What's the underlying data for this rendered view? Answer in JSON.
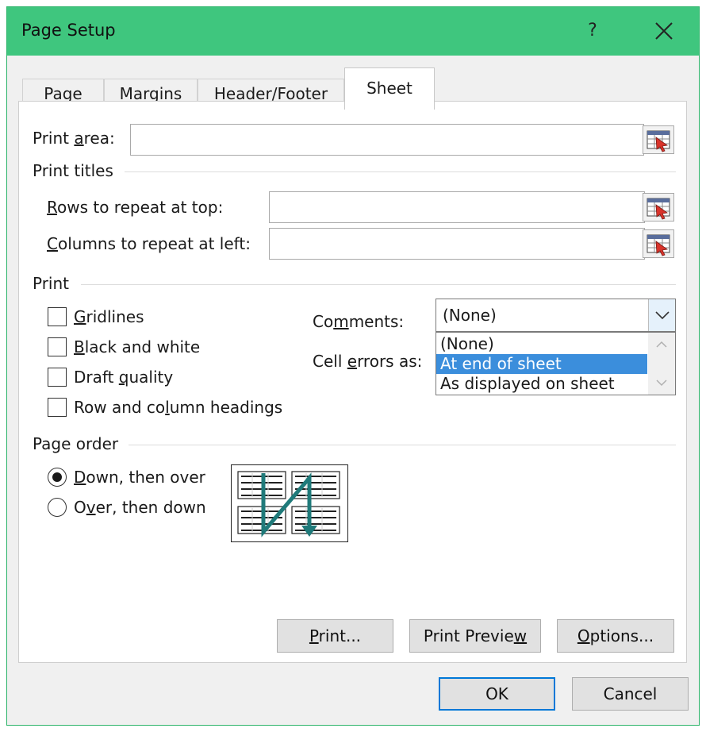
{
  "window": {
    "title": "Page Setup",
    "help_label": "?"
  },
  "tabs": [
    {
      "label": "Page",
      "active": false
    },
    {
      "label": "Margins",
      "active": false
    },
    {
      "label": "Header/Footer",
      "active": false
    },
    {
      "label": "Sheet",
      "active": true
    }
  ],
  "print_area": {
    "pre": "Print ",
    "accel": "a",
    "post": "rea:",
    "value": ""
  },
  "print_titles": {
    "heading": "Print titles",
    "rows": {
      "pre": "",
      "accel": "R",
      "post": "ows to repeat at top:",
      "value": ""
    },
    "columns": {
      "pre": "",
      "accel": "C",
      "post": "olumns to repeat at left:",
      "value": ""
    }
  },
  "print": {
    "heading": "Print",
    "gridlines": {
      "pre": "",
      "accel": "G",
      "post": "ridlines",
      "checked": false
    },
    "black_white": {
      "pre": "",
      "accel": "B",
      "post": "lack and white",
      "checked": false
    },
    "draft": {
      "pre": "Draft ",
      "accel": "q",
      "post": "uality",
      "checked": false
    },
    "headings": {
      "pre": "Row and co",
      "accel": "l",
      "post": "umn headings",
      "checked": false
    },
    "comments": {
      "pre": "Co",
      "accel": "m",
      "post": "ments:",
      "selected": "(None)"
    },
    "cell_errors": {
      "pre": "Cell ",
      "accel": "e",
      "post": "rrors as:"
    },
    "dropdown_options": [
      "(None)",
      "At end of sheet",
      "As displayed on sheet"
    ],
    "dropdown_highlighted": 1
  },
  "page_order": {
    "heading": "Page order",
    "down_then_over": {
      "pre": "",
      "accel": "D",
      "post": "own, then over",
      "selected": true
    },
    "over_then_down": {
      "pre": "O",
      "accel": "v",
      "post": "er, then down",
      "selected": false
    }
  },
  "buttons": {
    "print": {
      "pre": "",
      "accel": "P",
      "post": "rint..."
    },
    "print_preview": {
      "pre": "Print Previe",
      "accel": "w",
      "post": ""
    },
    "options": {
      "pre": "",
      "accel": "O",
      "post": "ptions..."
    },
    "ok": "OK",
    "cancel": "Cancel"
  },
  "colors": {
    "titlebar": "#3fc67e",
    "selection": "#3b8edc",
    "default_button_border": "#0078d7",
    "arrow_teal": "#1f7a7a"
  },
  "icons": [
    "close-icon",
    "range-select-icon",
    "chevron-down-icon",
    "chevron-up-icon",
    "page-order-icon"
  ]
}
